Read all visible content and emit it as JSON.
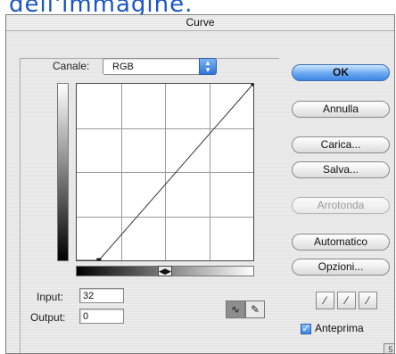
{
  "page_caption": "dell'immagine.",
  "dialog": {
    "title": "Curve",
    "channel_label": "Canale:",
    "channel_value": "RGB",
    "gradient_toggle_text": "◀▶",
    "input_label": "Input:",
    "input_value": "32",
    "output_label": "Output:",
    "output_value": "0",
    "buttons": {
      "ok": "OK",
      "cancel": "Annulla",
      "load": "Carica...",
      "save": "Salva...",
      "smooth": "Arrotonda",
      "auto": "Automatico",
      "options": "Opzioni..."
    },
    "preview_label": "Anteprima",
    "preview_checked": true,
    "resize_text": "5"
  },
  "curve": {
    "x_range": [
      0,
      255
    ],
    "y_range": [
      0,
      255
    ],
    "grid_divisions": 4,
    "points": [
      [
        32,
        0
      ],
      [
        255,
        255
      ]
    ]
  },
  "icons": {
    "curve_tool": "curve-tool-icon",
    "pencil_tool": "pencil-icon",
    "eyedroppers": [
      "black-eyedropper-icon",
      "gray-eyedropper-icon",
      "white-eyedropper-icon"
    ],
    "select_arrows": "updown-arrows-icon"
  },
  "colors": {
    "caption": "#1a55c8",
    "primary_button": "#3d86e4",
    "checkbox": "#3d86e4"
  }
}
